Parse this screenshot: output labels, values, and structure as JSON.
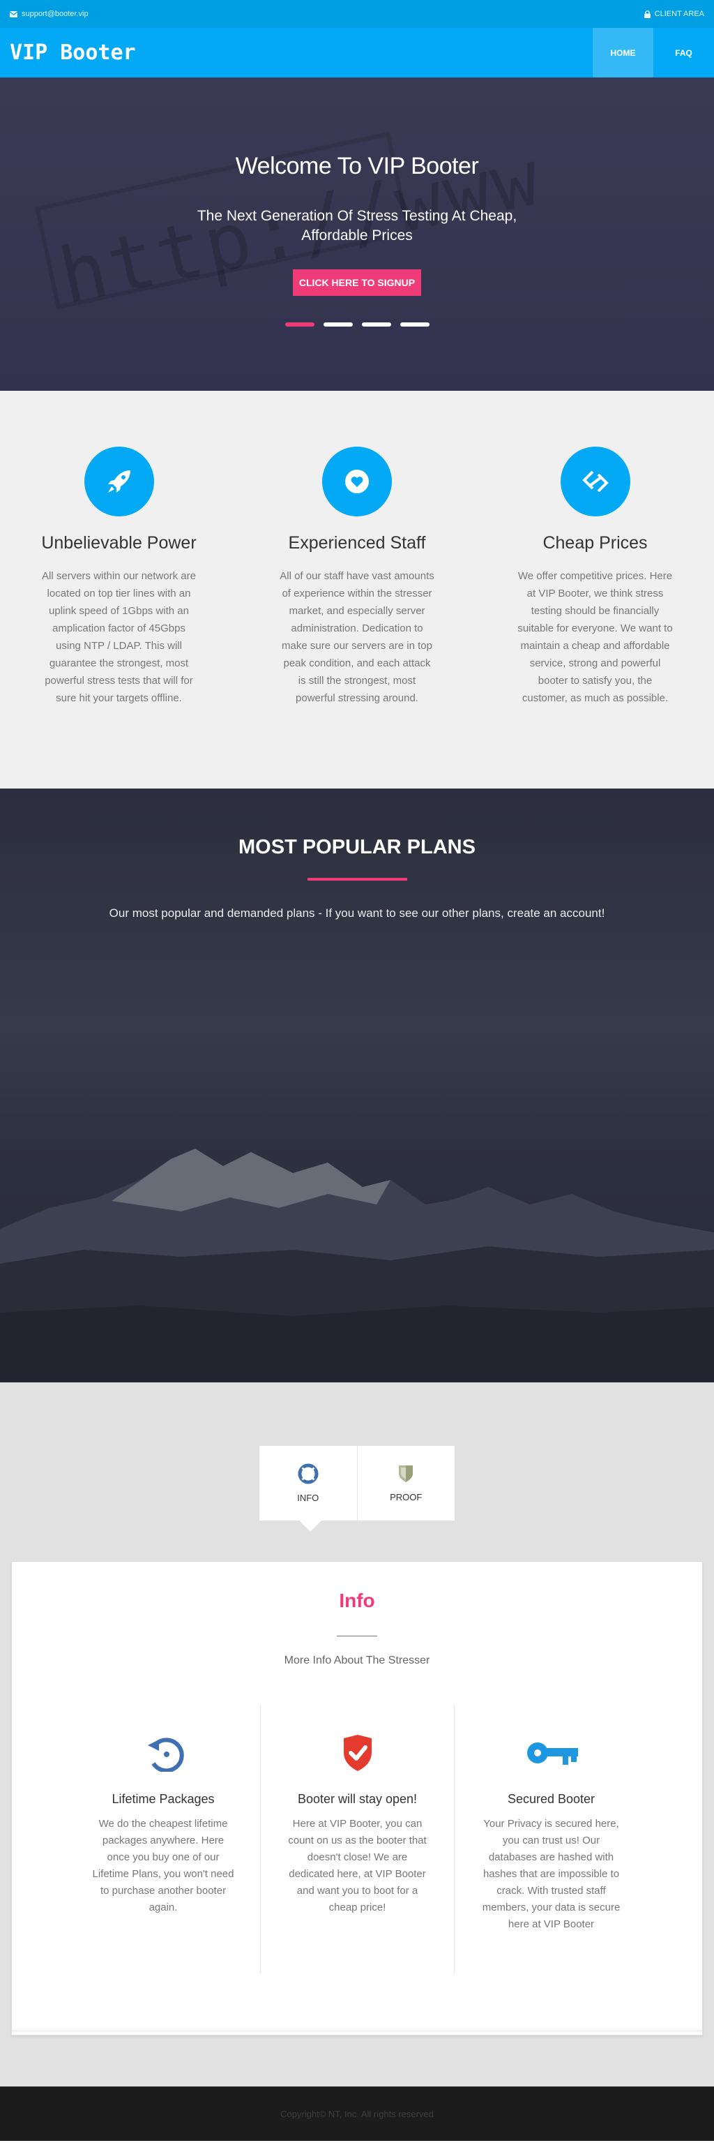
{
  "topbar": {
    "email": "support@booter.vip",
    "client_area": "CLIENT AREA",
    "email_icon": "envelope-icon",
    "client_icon": "lock-icon"
  },
  "header": {
    "logo": "VIP Booter",
    "nav": [
      {
        "label": "HOME"
      },
      {
        "label": "FAQ"
      }
    ]
  },
  "hero": {
    "title": "Welcome To VIP Booter",
    "subtitle": "The Next Generation Of Stress Testing At Cheap, Affordable Prices",
    "cta": "CLICK HERE TO SIGNUP",
    "background_text": "http://www"
  },
  "features": [
    {
      "icon": "rocket-icon",
      "title": "Unbelievable Power",
      "text": "All servers within our network are located on top tier lines with an uplink speed of 1Gbps with an amplication factor of 45Gbps using NTP / LDAP. This will guarantee the strongest, most powerful stress tests that will for sure hit your targets offline."
    },
    {
      "icon": "heart-icon",
      "title": "Experienced Staff",
      "text": "All of our staff have vast amounts of experience within the stresser market, and especially server administration. Dedication to make sure our servers are in top peak condition, and each attack is still the strongest, most powerful stressing around."
    },
    {
      "icon": "link-icon",
      "title": "Cheap Prices",
      "text": "We offer competitive prices. Here at VIP Booter, we think stress testing should be financially suitable for everyone. We want to maintain a cheap and affordable service, strong and powerful booter to satisfy you, the customer, as much as possible."
    }
  ],
  "plans": {
    "title": "MOST POPULAR PLANS",
    "text": "Our most popular and demanded plans - If you want to see our other plans, create an account!"
  },
  "tabs": [
    {
      "label": "INFO",
      "icon": "lifebuoy-icon"
    },
    {
      "label": "PROOF",
      "icon": "shield-icon"
    }
  ],
  "info": {
    "title": "Info",
    "subtitle": "More Info About The Stresser",
    "columns": [
      {
        "icon": "history-icon",
        "title": "Lifetime Packages",
        "text": "We do the cheapest lifetime packages anywhere. Here once you buy one of our Lifetime Plans, you won't need to purchase another booter again."
      },
      {
        "icon": "shield-check-icon",
        "title": "Booter will stay open!",
        "text": "Here at VIP Booter, you can count on us as the booter that doesn't close! We are dedicated here, at VIP Booter and want you to boot for a cheap price!"
      },
      {
        "icon": "key-icon",
        "title": "Secured Booter",
        "text": "Your Privacy is secured here, you can trust us! Our databases are hashed with hashes that are impossible to crack. With trusted staff members, your data is secure here at VIP Booter"
      }
    ]
  },
  "footer": {
    "text": "Copyright© NT, Inc. All rights reserved"
  },
  "colors": {
    "primary": "#03a9f4",
    "topbar": "#009fe3",
    "accent": "#ef3c78"
  }
}
